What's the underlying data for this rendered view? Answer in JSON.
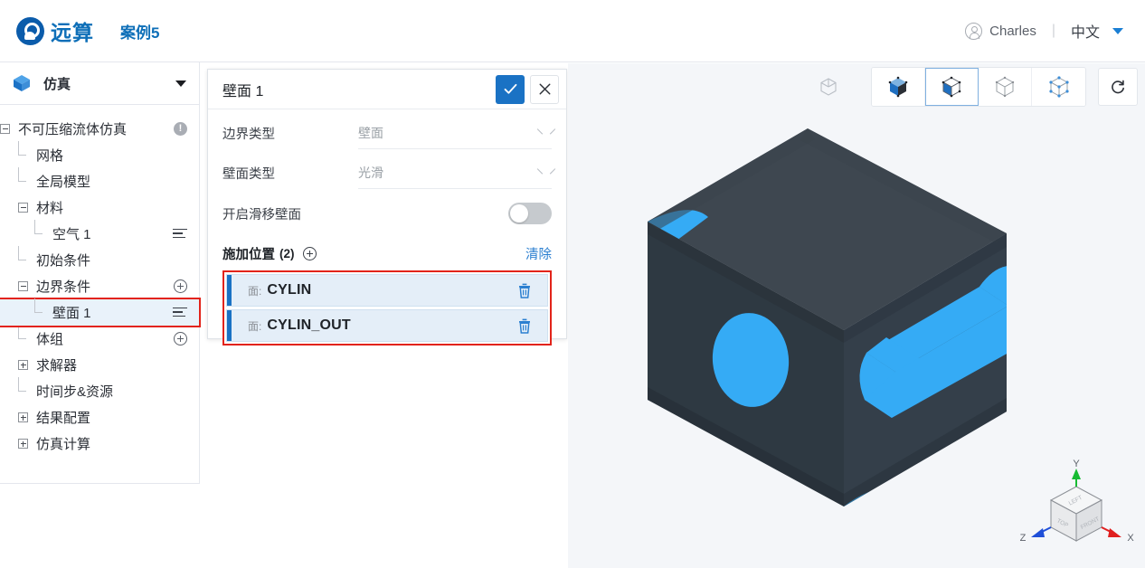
{
  "header": {
    "brand_name": "远算",
    "case_title": "案例5",
    "user_name": "Charles",
    "separator": "|",
    "language": "中文",
    "avatar_icon": "user-circle-icon",
    "caret_icon": "chevron-down-icon"
  },
  "sidebar": {
    "head_label": "仿真",
    "head_icon": "cube-icon",
    "collapse_icon": "chevron-down-icon",
    "tree": [
      {
        "label": "不可压缩流体仿真",
        "indent": 0,
        "toggle": "minus",
        "right_icon": "warning-circle-icon",
        "right_glyph": "!",
        "selected": false,
        "highlight": false
      },
      {
        "label": "网格",
        "indent": 1,
        "toggle": "stub",
        "right_icon": "",
        "right_glyph": "",
        "selected": false,
        "highlight": false
      },
      {
        "label": "全局模型",
        "indent": 1,
        "toggle": "stub",
        "right_icon": "",
        "right_glyph": "",
        "selected": false,
        "highlight": false
      },
      {
        "label": "材料",
        "indent": 1,
        "toggle": "minus",
        "right_icon": "",
        "right_glyph": "",
        "selected": false,
        "highlight": false
      },
      {
        "label": "空气 1",
        "indent": 2,
        "toggle": "stub",
        "right_icon": "list-menu-icon",
        "right_glyph": "",
        "selected": false,
        "highlight": false
      },
      {
        "label": "初始条件",
        "indent": 1,
        "toggle": "stub",
        "right_icon": "",
        "right_glyph": "",
        "selected": false,
        "highlight": false
      },
      {
        "label": "边界条件",
        "indent": 1,
        "toggle": "minus",
        "right_icon": "plus-circle-icon",
        "right_glyph": "",
        "selected": false,
        "highlight": false
      },
      {
        "label": "壁面 1",
        "indent": 2,
        "toggle": "stub",
        "right_icon": "list-menu-icon",
        "right_glyph": "",
        "selected": true,
        "highlight": true
      },
      {
        "label": "体组",
        "indent": 1,
        "toggle": "stub",
        "right_icon": "plus-circle-icon",
        "right_glyph": "",
        "selected": false,
        "highlight": false
      },
      {
        "label": "求解器",
        "indent": 1,
        "toggle": "plus",
        "right_icon": "",
        "right_glyph": "",
        "selected": false,
        "highlight": false
      },
      {
        "label": "时间步&资源",
        "indent": 1,
        "toggle": "stub",
        "right_icon": "",
        "right_glyph": "",
        "selected": false,
        "highlight": false
      },
      {
        "label": "结果配置",
        "indent": 1,
        "toggle": "plus",
        "right_icon": "",
        "right_glyph": "",
        "selected": false,
        "highlight": false
      },
      {
        "label": "仿真计算",
        "indent": 1,
        "toggle": "plus",
        "right_icon": "",
        "right_glyph": "",
        "selected": false,
        "highlight": false
      }
    ]
  },
  "panel": {
    "title": "壁面 1",
    "confirm_icon": "check-icon",
    "cancel_icon": "close-icon",
    "fields": [
      {
        "label": "边界类型",
        "value": "壁面",
        "chevron": "chevron-down-icon"
      },
      {
        "label": "壁面类型",
        "value": "光滑",
        "chevron": "chevron-down-icon"
      }
    ],
    "toggle": {
      "label": "开启滑移壁面",
      "on": false
    },
    "section": {
      "title": "施加位置",
      "count": "(2)",
      "add_icon": "plus-circle-icon",
      "clear_label": "清除"
    },
    "selection_items": [
      {
        "prefix": "面:",
        "name": "CYLIN",
        "delete_icon": "trash-icon"
      },
      {
        "prefix": "面:",
        "name": "CYLIN_OUT",
        "delete_icon": "trash-icon"
      }
    ]
  },
  "viewport": {
    "toolbar": [
      {
        "name": "wireframe-cube-icon",
        "active": false,
        "standalone": true
      },
      {
        "name": "shaded-cube-icon",
        "active": false,
        "standalone": false
      },
      {
        "name": "shaded-edges-cube-icon",
        "active": true,
        "standalone": false
      },
      {
        "name": "hidden-line-cube-icon",
        "active": false,
        "standalone": false
      },
      {
        "name": "points-cube-icon",
        "active": false,
        "standalone": false
      },
      {
        "name": "reset-view-icon",
        "active": false,
        "standalone": true
      }
    ],
    "gizmo": {
      "axis_x_label": "X",
      "axis_y_label": "Y",
      "axis_z_label": "Z",
      "face_top": "LEFT",
      "face_left": "TOP",
      "face_right": "FRONT",
      "axis_x_color": "#e02020",
      "axis_y_color": "#17bb33",
      "axis_z_color": "#1f4fd8"
    },
    "model": {
      "body_color": "#3a424c",
      "face_color": "#2f3a47",
      "highlight_color": "#35a9f4",
      "background": "#f4f6f9"
    }
  },
  "colors": {
    "accent": "#1a72c4",
    "brand": "#0e6fb8",
    "highlight_outline": "#e2231a",
    "link": "#2b7fd0"
  }
}
